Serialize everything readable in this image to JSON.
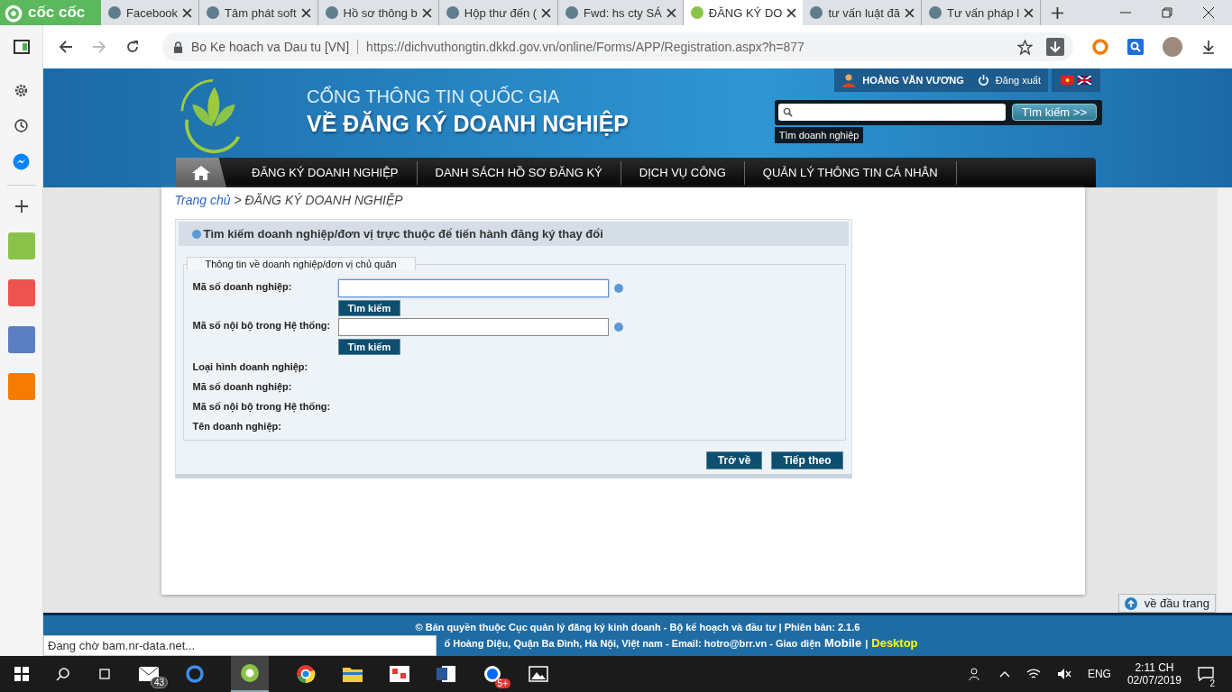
{
  "browser": {
    "brand": "cốc cốc",
    "tabs": [
      {
        "title": "Facebook",
        "selected": false
      },
      {
        "title": "Tâm phát soft",
        "selected": false
      },
      {
        "title": "Hồ sơ thông b",
        "selected": false
      },
      {
        "title": "Hộp thư đến (",
        "selected": false
      },
      {
        "title": "Fwd: hs cty SÁ",
        "selected": false
      },
      {
        "title": "ĐĂNG KÝ DO",
        "selected": true
      },
      {
        "title": "tư vấn luật đă",
        "selected": false
      },
      {
        "title": "Tư vấn pháp l",
        "selected": false
      }
    ],
    "site_name": "Bo Ke hoach va Dau tu [VN]",
    "url": "https://dichvuthongtin.dkkd.gov.vn/online/Forms/APP/Registration.aspx?h=877",
    "status_text": "Đang chờ bam.nr-data.net..."
  },
  "header": {
    "title_line1": "CỔNG THÔNG TIN QUỐC GIA",
    "title_line2": "VỀ ĐĂNG KÝ DOANH NGHIỆP",
    "user": "HOÀNG VĂN VƯƠNG",
    "logout": "Đăng xuất",
    "search_button": "Tìm kiếm >>",
    "search_tooltip": "Tìm doanh nghiệp"
  },
  "nav": {
    "items": [
      "ĐĂNG KÝ DOANH NGHIỆP",
      "DANH SÁCH HỒ SƠ ĐĂNG KÝ",
      "DỊCH VỤ CÔNG",
      "QUẢN LÝ THÔNG TIN CÁ NHÂN"
    ]
  },
  "breadcrumb": {
    "home": "Trang chủ",
    "current": "> ĐĂNG KÝ DOANH NGHIỆP"
  },
  "panel": {
    "title": "Tìm kiếm doanh nghiệp/đơn vị trực thuộc để tiến hành đăng ký thay đổi",
    "legend": "Thông tin về doanh nghiệp/đơn vị chủ quản",
    "fields": [
      {
        "label": "Mã số doanh nghiệp:",
        "button": "Tìm kiếm",
        "focused": true
      },
      {
        "label": "Mã số nội bộ trong Hệ thống:",
        "button": "Tìm kiếm",
        "focused": false
      }
    ],
    "info_labels": [
      "Loại hình doanh nghiệp:",
      "Mã số doanh nghiệp:",
      "Mã số nội bộ trong Hệ thống:",
      "Tên doanh nghiệp:"
    ],
    "buttons": [
      "Trở về",
      "Tiếp theo"
    ]
  },
  "back_to_top": "về đầu trang",
  "footer": {
    "copyright": "© Bản quyền thuộc Cục quản lý đăng ký kinh doanh - Bộ kế hoạch và đầu tư | Phiên bản: 2.1.6",
    "address": "ố Hoàng Diệu, Quận Ba Đình, Hà Nội, Việt nam - Email: **hotro@brr.vn** - Giao diện",
    "mobile": "Mobile",
    "separator": "|",
    "desktop": "Desktop"
  },
  "taskbar": {
    "mail_badge": "43",
    "zalo_badge": "5+",
    "language": "ENG",
    "time": "2:11 CH",
    "date": "02/07/2019",
    "notification_count": "2"
  }
}
